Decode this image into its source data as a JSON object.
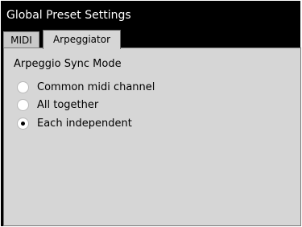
{
  "window": {
    "title": "Global Preset Settings"
  },
  "tabs": [
    {
      "label": "MIDI",
      "active": false
    },
    {
      "label": "Arpeggiator",
      "active": true
    }
  ],
  "arpeggiator": {
    "group_label": "Arpeggio Sync Mode",
    "options": [
      {
        "label": "Common midi channel",
        "checked": false
      },
      {
        "label": "All together",
        "checked": false
      },
      {
        "label": "Each independent",
        "checked": true
      }
    ]
  }
}
